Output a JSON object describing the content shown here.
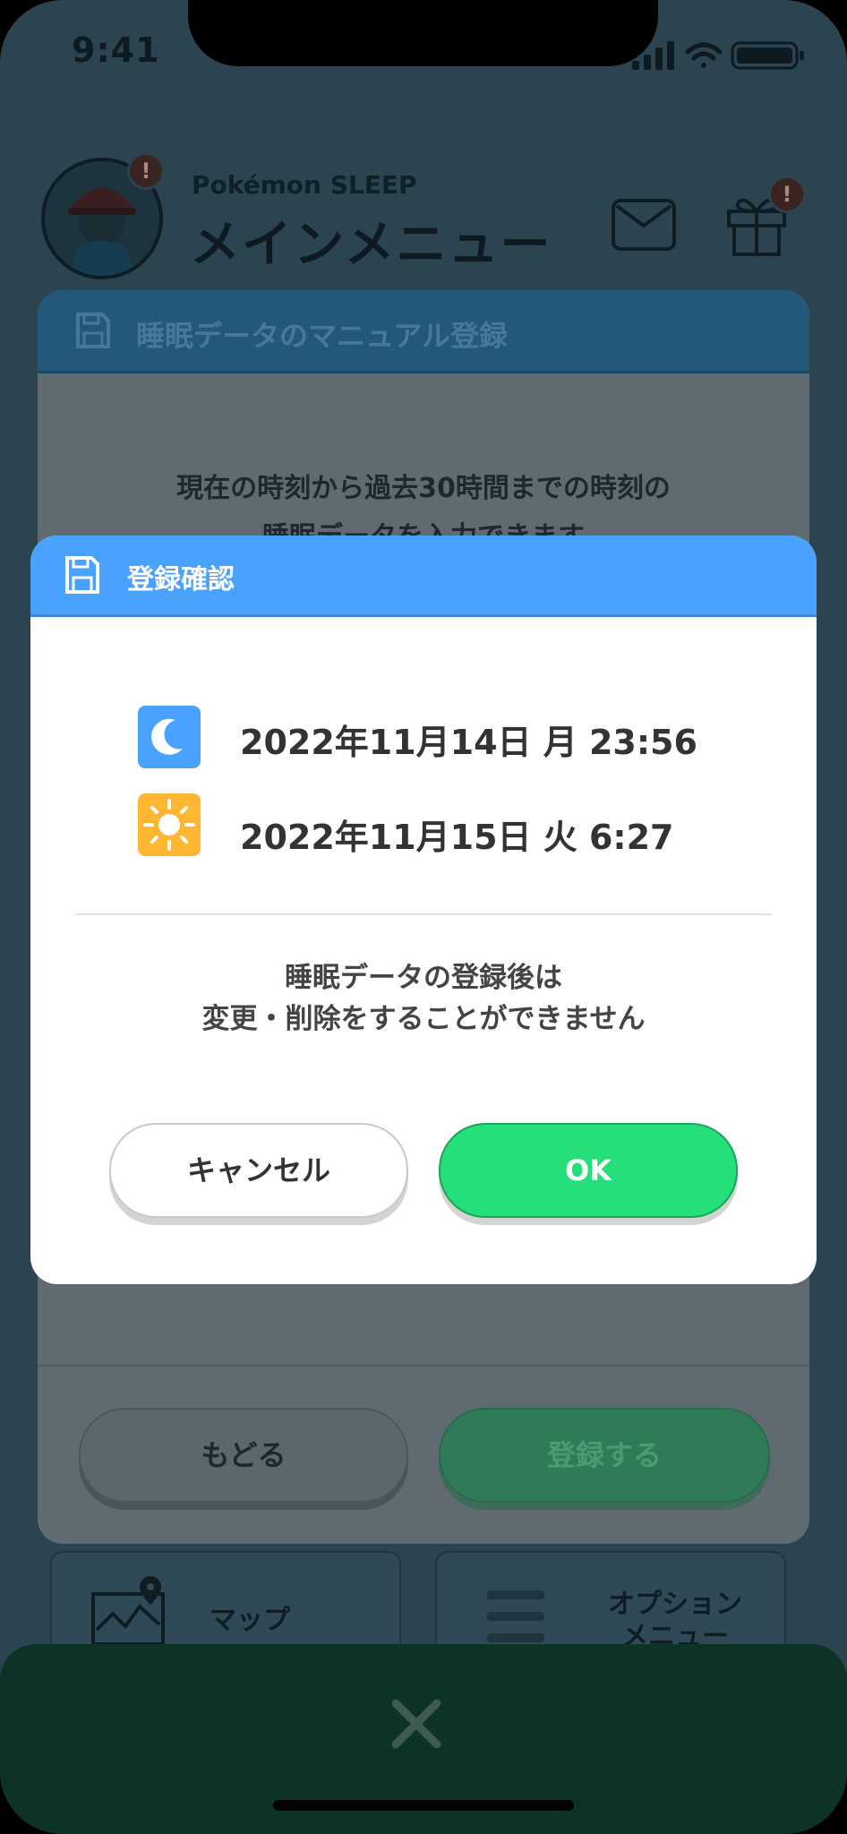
{
  "status": {
    "time": "9:41"
  },
  "header": {
    "brand": "Pokémon SLEEP",
    "title": "メインメニュー",
    "avatar_badge": "!",
    "gift_badge": "!"
  },
  "background_card": {
    "title": "睡眠データのマニュアル登録",
    "desc_line1": "現在の時刻から過去30時間までの時刻の",
    "desc_line2": "睡眠データを入力できます",
    "back_label": "もどる",
    "register_label": "登録する"
  },
  "tiles": {
    "map_label": "マップ",
    "options_line1": "オプション",
    "options_line2": "メニュー"
  },
  "dialog": {
    "title": "登録確認",
    "sleep_time": "2022年11月14日 月 23:56",
    "wake_time": "2022年11月15日 火 6:27",
    "note_line1": "睡眠データの登録後は",
    "note_line2": "変更・削除をすることができません",
    "cancel_label": "キャンセル",
    "ok_label": "OK"
  },
  "icons": {
    "sleep": "moon-icon",
    "wake": "sun-icon",
    "save": "floppy-disk-icon",
    "close": "close-icon"
  },
  "colors": {
    "dialog_header": "#4aa2ff",
    "ok_button": "#25e07a",
    "moon_tile": "#4aa2ff",
    "sun_tile": "#ffb630"
  }
}
